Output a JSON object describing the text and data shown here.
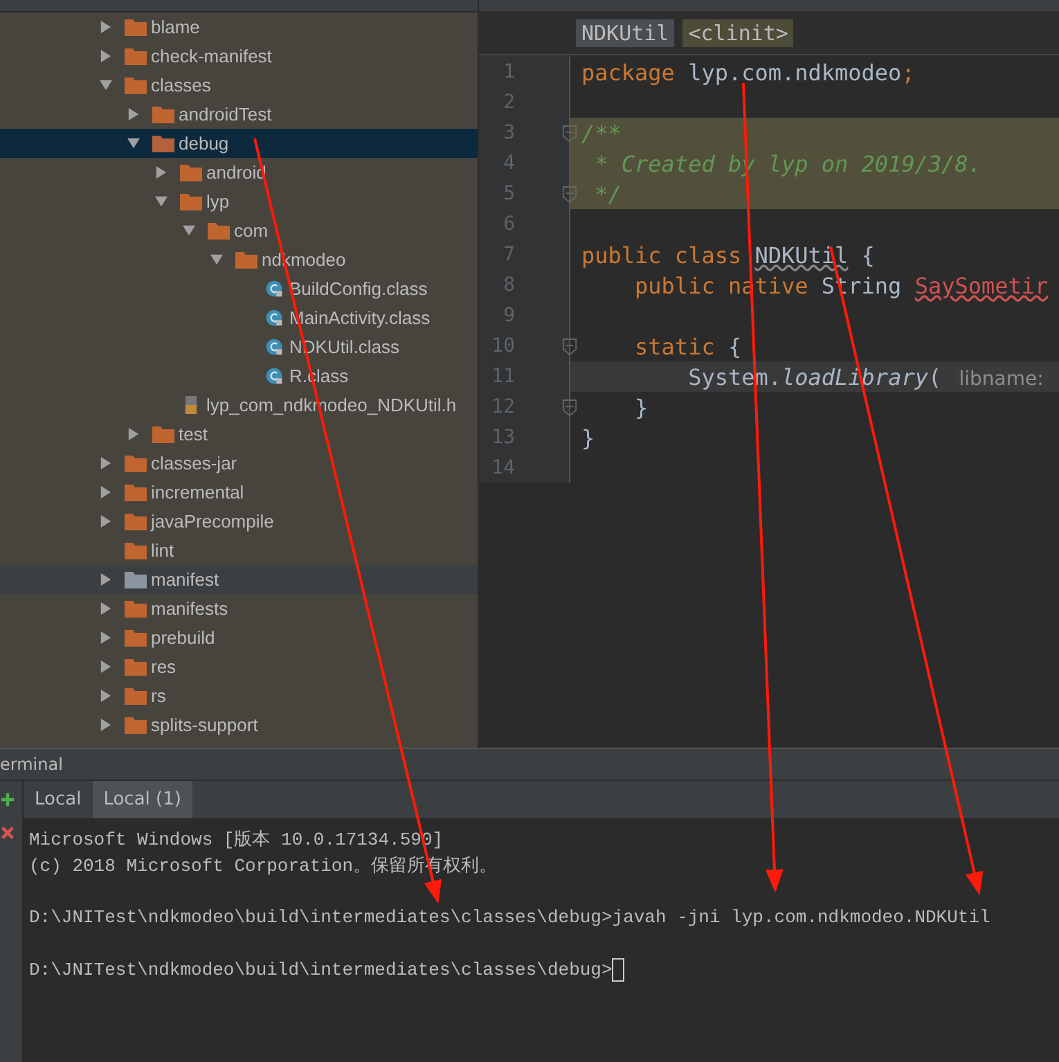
{
  "project_tree": [
    {
      "name": "blame",
      "kind": "folder",
      "expanded": false,
      "selected": false
    },
    {
      "name": "check-manifest",
      "kind": "folder",
      "expanded": false,
      "selected": false
    },
    {
      "name": "classes",
      "kind": "folder",
      "expanded": true,
      "selected": false,
      "children": [
        {
          "name": "androidTest",
          "kind": "folder",
          "expanded": false,
          "selected": false
        },
        {
          "name": "debug",
          "kind": "folder",
          "expanded": true,
          "selected": true,
          "children": [
            {
              "name": "android",
              "kind": "folder",
              "expanded": false,
              "selected": false
            },
            {
              "name": "lyp",
              "kind": "folder",
              "expanded": true,
              "selected": false,
              "children": [
                {
                  "name": "com",
                  "kind": "folder",
                  "expanded": true,
                  "selected": false,
                  "children": [
                    {
                      "name": "ndkmodeo",
                      "kind": "folder",
                      "expanded": true,
                      "selected": false,
                      "children": [
                        {
                          "name": "BuildConfig.class",
                          "kind": "class",
                          "selected": false
                        },
                        {
                          "name": "MainActivity.class",
                          "kind": "class",
                          "selected": false
                        },
                        {
                          "name": "NDKUtil.class",
                          "kind": "class",
                          "selected": false
                        },
                        {
                          "name": "R.class",
                          "kind": "class",
                          "selected": false
                        }
                      ]
                    }
                  ]
                }
              ]
            },
            {
              "name": "lyp_com_ndkmodeo_NDKUtil.h",
              "kind": "header",
              "selected": false
            }
          ]
        },
        {
          "name": "test",
          "kind": "folder",
          "expanded": false,
          "selected": false
        }
      ]
    },
    {
      "name": "classes-jar",
      "kind": "folder",
      "expanded": false,
      "selected": false
    },
    {
      "name": "incremental",
      "kind": "folder",
      "expanded": false,
      "selected": false
    },
    {
      "name": "javaPrecompile",
      "kind": "folder",
      "expanded": false,
      "selected": false
    },
    {
      "name": "lint",
      "kind": "empty-folder",
      "selected": false
    },
    {
      "name": "manifest",
      "kind": "grey-folder",
      "expanded": false,
      "selected": false
    },
    {
      "name": "manifests",
      "kind": "folder",
      "expanded": false,
      "selected": false
    },
    {
      "name": "prebuild",
      "kind": "folder",
      "expanded": false,
      "selected": false
    },
    {
      "name": "res",
      "kind": "folder",
      "expanded": false,
      "selected": false
    },
    {
      "name": "rs",
      "kind": "folder",
      "expanded": false,
      "selected": false
    },
    {
      "name": "splits-support",
      "kind": "folder",
      "expanded": false,
      "selected": false
    }
  ],
  "breadcrumbs": [
    {
      "label": "NDKUtil",
      "kind": "class"
    },
    {
      "label": "<clinit>",
      "kind": "method"
    }
  ],
  "code_lines": [
    {
      "number": "1",
      "selected": false,
      "caret_line": false,
      "fold": false,
      "tokens": [
        {
          "kind": "keyword",
          "text": "package "
        },
        {
          "kind": "plain",
          "text": "lyp.com.ndkmodeo"
        },
        {
          "kind": "keyword",
          "text": ";"
        }
      ]
    },
    {
      "number": "2",
      "selected": false,
      "caret_line": false,
      "fold": false
    },
    {
      "number": "3",
      "selected": true,
      "caret_line": false,
      "fold": true,
      "tokens": [
        {
          "kind": "comment",
          "text": "/**"
        }
      ]
    },
    {
      "number": "4",
      "selected": true,
      "caret_line": false,
      "fold": false,
      "tokens": [
        {
          "kind": "comment",
          "text": " * Created by lyp on 2019/3/8."
        }
      ]
    },
    {
      "number": "5",
      "selected": true,
      "caret_line": false,
      "fold": true,
      "tokens": [
        {
          "kind": "comment",
          "text": " */"
        }
      ]
    },
    {
      "number": "6",
      "selected": false,
      "caret_line": false,
      "fold": false
    },
    {
      "number": "7",
      "selected": false,
      "caret_line": false,
      "fold": false,
      "tokens": [
        {
          "kind": "keyword",
          "text": "public class "
        },
        {
          "kind": "warning",
          "text": "NDKUtil"
        },
        {
          "kind": "plain",
          "text": " {"
        }
      ]
    },
    {
      "number": "8",
      "selected": false,
      "caret_line": false,
      "fold": false,
      "tokens": [
        {
          "kind": "keyword",
          "text": "    public native "
        },
        {
          "kind": "plain",
          "text": "String "
        },
        {
          "kind": "error",
          "text": "SaySometir"
        }
      ]
    },
    {
      "number": "9",
      "selected": false,
      "caret_line": false,
      "fold": false
    },
    {
      "number": "10",
      "selected": false,
      "caret_line": false,
      "fold": true,
      "tokens": [
        {
          "kind": "keyword",
          "text": "    static "
        },
        {
          "kind": "plain",
          "text": "{"
        }
      ]
    },
    {
      "number": "11",
      "selected": false,
      "caret_line": true,
      "fold": false,
      "tokens": [
        {
          "kind": "plain",
          "text": "        System."
        },
        {
          "kind": "method",
          "text": "loadLibrary"
        },
        {
          "kind": "plain",
          "text": "( "
        },
        {
          "kind": "hint",
          "text": "libname:"
        }
      ]
    },
    {
      "number": "12",
      "selected": false,
      "caret_line": false,
      "fold": true,
      "tokens": [
        {
          "kind": "plain",
          "text": "    }"
        }
      ]
    },
    {
      "number": "13",
      "selected": false,
      "caret_line": false,
      "fold": false,
      "tokens": [
        {
          "kind": "plain",
          "text": "}"
        }
      ]
    },
    {
      "number": "14",
      "selected": false,
      "caret_line": false,
      "fold": false
    }
  ],
  "terminal": {
    "title": "erminal",
    "tabs": [
      {
        "label": "Local",
        "selected": false
      },
      {
        "label": "Local (1)",
        "selected": true
      }
    ],
    "lines": [
      {
        "kind": "output",
        "text": "Microsoft Windows [版本 10.0.17134.590]"
      },
      {
        "kind": "output",
        "text": "(c) 2018 Microsoft Corporation。保留所有权利。"
      },
      {
        "kind": "command",
        "text": "D:\\JNITest\\ndkmodeo\\build\\intermediates\\classes\\debug>javah -jni lyp.com.ndkmodeo.NDKUtil"
      },
      {
        "kind": "command",
        "text": "D:\\JNITest\\ndkmodeo\\build\\intermediates\\classes\\debug>"
      }
    ],
    "cursor": true
  }
}
